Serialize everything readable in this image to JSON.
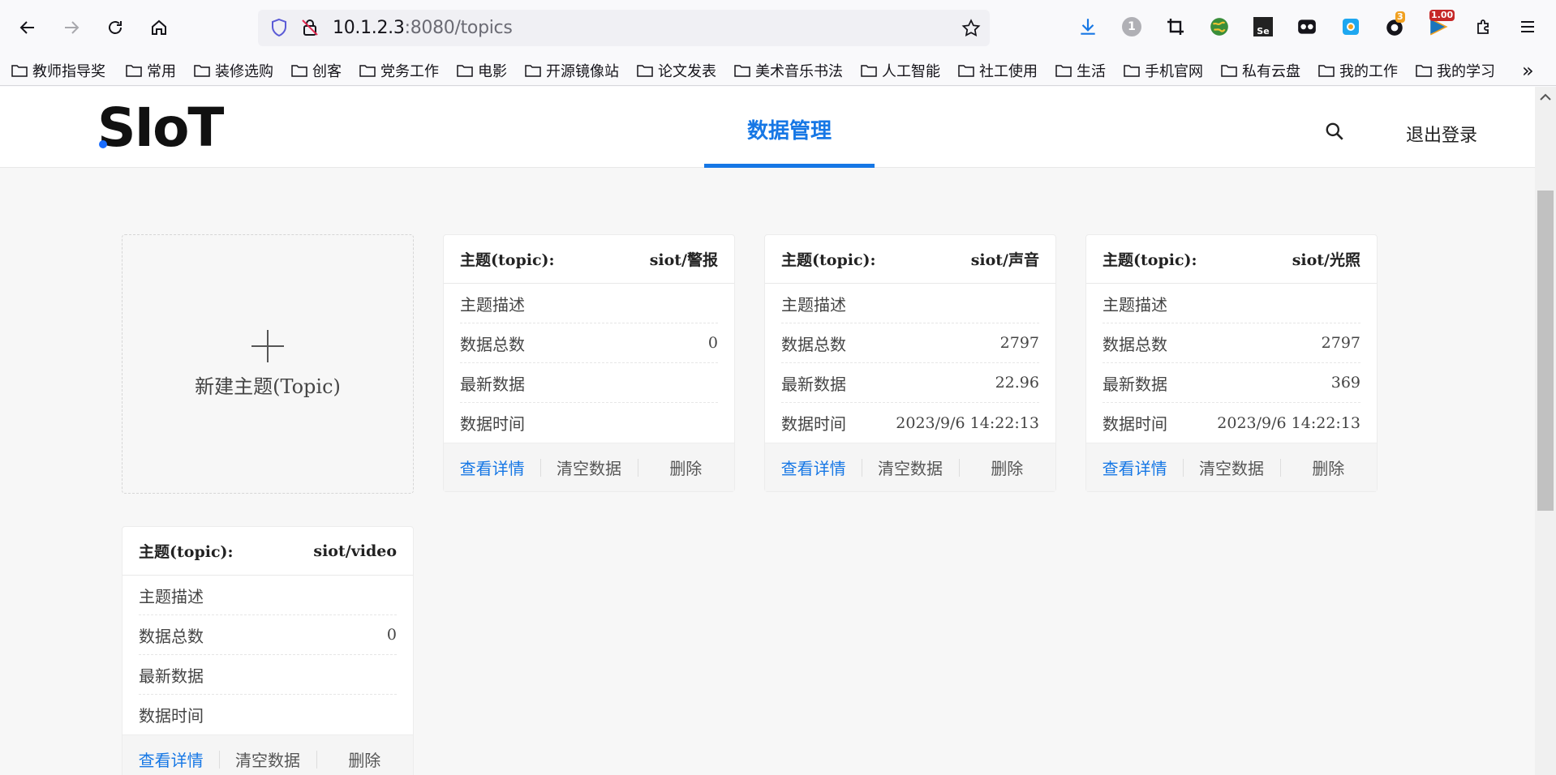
{
  "browser": {
    "url_host": "10.1.2.3",
    "url_rest": ":8080/topics",
    "ext_badge_count": "3",
    "ext_badge_value": "1.00",
    "ext_circle_label": "1",
    "bookmarks": [
      "教师指导奖",
      "常用",
      "装修选购",
      "创客",
      "党务工作",
      "电影",
      "开源镜像站",
      "论文发表",
      "美术音乐书法",
      "人工智能",
      "社工使用",
      "生活",
      "手机官网",
      "私有云盘",
      "我的工作",
      "我的学习"
    ],
    "overflow_label": "»"
  },
  "header": {
    "logo": "SIoT",
    "nav_tab": "数据管理",
    "logout": "退出登录"
  },
  "new_topic": {
    "label": "新建主题(Topic)"
  },
  "labels": {
    "topic": "主题(topic):",
    "desc": "主题描述",
    "count": "数据总数",
    "latest": "最新数据",
    "time": "数据时间",
    "view": "查看详情",
    "clear": "清空数据",
    "delete": "删除"
  },
  "topics": [
    {
      "name": "siot/警报",
      "desc": "",
      "count": "0",
      "latest": "",
      "time": ""
    },
    {
      "name": "siot/声音",
      "desc": "",
      "count": "2797",
      "latest": "22.96",
      "time": "2023/9/6 14:22:13"
    },
    {
      "name": "siot/光照",
      "desc": "",
      "count": "2797",
      "latest": "369",
      "time": "2023/9/6 14:22:13"
    },
    {
      "name": "siot/video",
      "desc": "",
      "count": "0",
      "latest": "",
      "time": ""
    }
  ]
}
